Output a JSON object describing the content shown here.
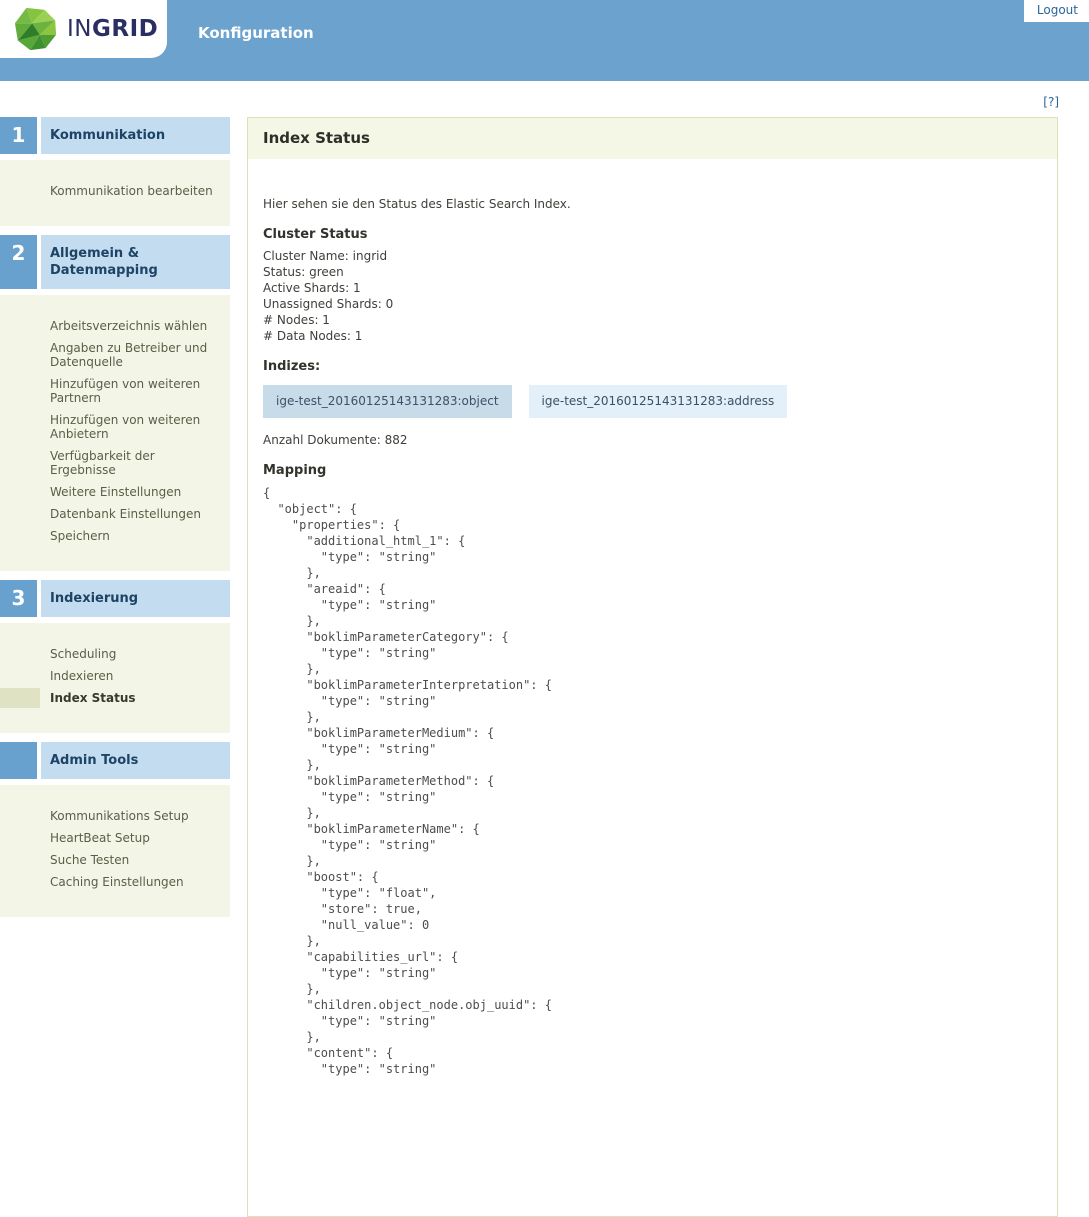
{
  "header": {
    "brand_in": "IN",
    "brand_grid": "GRID",
    "app_title": "Konfiguration",
    "logout_label": "Logout",
    "help_label": "[?]"
  },
  "colors": {
    "header_blue": "#6ca2ce",
    "section_number_blue": "#69a1ce",
    "section_bar_blue": "#c3dcf0",
    "sidebar_cream": "#f3f6e6",
    "active_marker_olive": "#dfe3c3",
    "content_border_olive": "#dce1b8",
    "index_button_active": "#c7dbe8",
    "index_button_inactive": "#e3f0f9",
    "link_blue": "#2a649c"
  },
  "sidebar": {
    "sections": [
      {
        "number": "1",
        "title": "Kommunikation",
        "items": [
          {
            "label": "Kommunikation bearbeiten",
            "active": false
          }
        ]
      },
      {
        "number": "2",
        "title": "Allgemein & Datenmapping",
        "items": [
          {
            "label": "Arbeitsverzeichnis wählen",
            "active": false
          },
          {
            "label": "Angaben zu Betreiber und Datenquelle",
            "active": false
          },
          {
            "label": "Hinzufügen von weiteren Partnern",
            "active": false
          },
          {
            "label": "Hinzufügen von weiteren Anbietern",
            "active": false
          },
          {
            "label": "Verfügbarkeit der Ergebnisse",
            "active": false
          },
          {
            "label": "Weitere Einstellungen",
            "active": false
          },
          {
            "label": "Datenbank Einstellungen",
            "active": false
          },
          {
            "label": "Speichern",
            "active": false
          }
        ]
      },
      {
        "number": "3",
        "title": "Indexierung",
        "items": [
          {
            "label": "Scheduling",
            "active": false
          },
          {
            "label": "Indexieren",
            "active": false
          },
          {
            "label": "Index Status",
            "active": true
          }
        ]
      },
      {
        "number": "",
        "title": "Admin Tools",
        "items": [
          {
            "label": "Kommunikations Setup",
            "active": false
          },
          {
            "label": "HeartBeat Setup",
            "active": false
          },
          {
            "label": "Suche Testen",
            "active": false
          },
          {
            "label": "Caching Einstellungen",
            "active": false
          }
        ]
      }
    ]
  },
  "main": {
    "title": "Index Status",
    "intro": "Hier sehen sie den Status des Elastic Search Index.",
    "cluster": {
      "heading": "Cluster Status",
      "lines": [
        "Cluster Name: ingrid",
        "Status: green",
        "Active Shards: 1",
        "Unassigned Shards: 0",
        "# Nodes: 1",
        "# Data Nodes: 1"
      ]
    },
    "indizes_heading": "Indizes:",
    "index_buttons": [
      {
        "label": "ige-test_20160125143131283:object",
        "active": true
      },
      {
        "label": "ige-test_20160125143131283:address",
        "active": false
      }
    ],
    "doc_count": "Anzahl Dokumente: 882",
    "mapping_heading": "Mapping",
    "mapping_json": "{\n  \"object\": {\n    \"properties\": {\n      \"additional_html_1\": {\n        \"type\": \"string\"\n      },\n      \"areaid\": {\n        \"type\": \"string\"\n      },\n      \"boklimParameterCategory\": {\n        \"type\": \"string\"\n      },\n      \"boklimParameterInterpretation\": {\n        \"type\": \"string\"\n      },\n      \"boklimParameterMedium\": {\n        \"type\": \"string\"\n      },\n      \"boklimParameterMethod\": {\n        \"type\": \"string\"\n      },\n      \"boklimParameterName\": {\n        \"type\": \"string\"\n      },\n      \"boost\": {\n        \"type\": \"float\",\n        \"store\": true,\n        \"null_value\": 0\n      },\n      \"capabilities_url\": {\n        \"type\": \"string\"\n      },\n      \"children.object_node.obj_uuid\": {\n        \"type\": \"string\"\n      },\n      \"content\": {\n        \"type\": \"string\""
  }
}
